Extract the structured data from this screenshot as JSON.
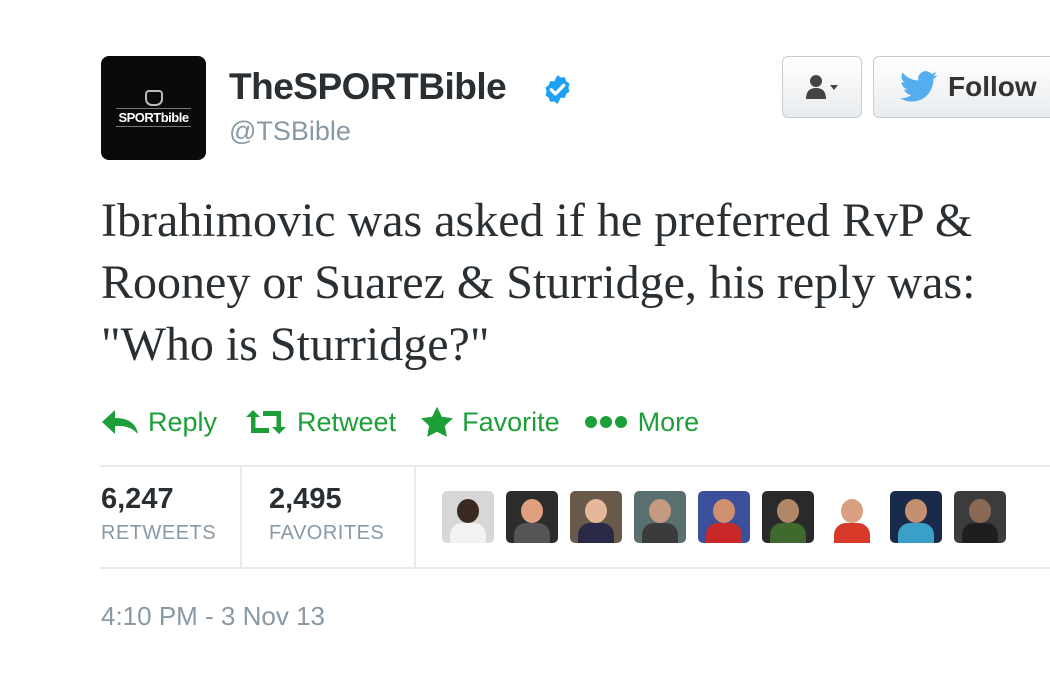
{
  "account": {
    "avatar_logo_text": "SPORTbible",
    "display_name": "TheSPORTBible",
    "handle": "@TSBible",
    "verified": true
  },
  "header_buttons": {
    "user_dropdown_icon": "person-icon",
    "follow_label": "Follow",
    "follow_icon": "twitter-bird-icon"
  },
  "tweet": {
    "lines": [
      "Ibrahimovic was asked if he preferred RvP &",
      "Rooney or Suarez & Sturridge, his reply was:",
      "\"Who is Sturridge?\""
    ]
  },
  "actions": [
    {
      "label": "Reply",
      "icon": "reply-icon"
    },
    {
      "label": "Retweet",
      "icon": "retweet-icon"
    },
    {
      "label": "Favorite",
      "icon": "star-icon"
    },
    {
      "label": "More",
      "icon": "more-dots-icon"
    }
  ],
  "stats": {
    "retweets": {
      "count": "6,247",
      "label": "RETWEETS"
    },
    "favorites": {
      "count": "2,495",
      "label": "FAVORITES"
    }
  },
  "favoriter_avatars": [
    {
      "bg": "#d7d7d7",
      "head": "#3a2a22",
      "body": "#f2f2f2"
    },
    {
      "bg": "#2c2c2c",
      "head": "#e0a080",
      "body": "#555555"
    },
    {
      "bg": "#6a5a4c",
      "head": "#e6b89a",
      "body": "#2a2a48"
    },
    {
      "bg": "#5a7070",
      "head": "#c59a80",
      "body": "#3b3b3b"
    },
    {
      "bg": "#3b4f9a",
      "head": "#d09070",
      "body": "#c82828"
    },
    {
      "bg": "#2a2a2a",
      "head": "#b08868",
      "body": "#3e6a2e"
    },
    {
      "bg": "#ffffff",
      "head": "#d8a080",
      "body": "#d83a2a"
    },
    {
      "bg": "#1a2a4a",
      "head": "#c59070",
      "body": "#3aa0c8"
    },
    {
      "bg": "#3c3c3c",
      "head": "#8a6a55",
      "body": "#1e1e1e"
    }
  ],
  "timestamp": "4:10 PM - 3 Nov 13",
  "colors": {
    "action_green": "#1c9e38",
    "verified_blue": "#1da1f2",
    "twitter_bird": "#55acee",
    "muted_text": "#8899a6"
  }
}
